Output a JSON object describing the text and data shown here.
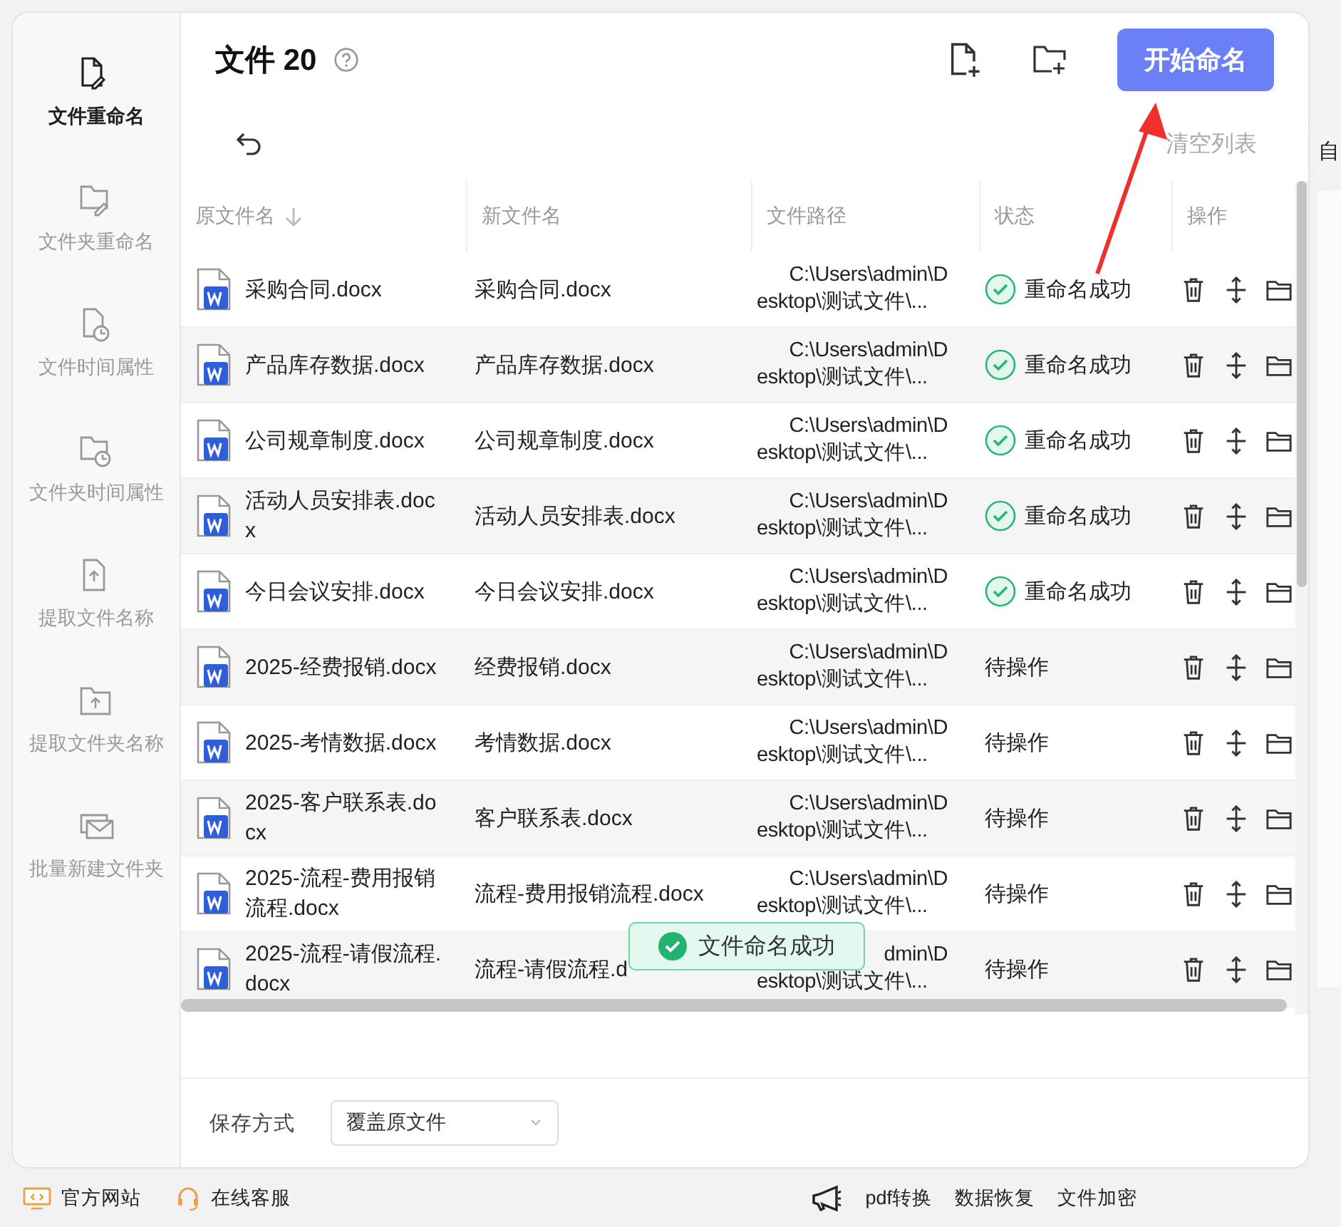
{
  "sidebar": {
    "items": [
      {
        "label": "文件重命名",
        "selected": true
      },
      {
        "label": "文件夹重命名",
        "selected": false
      },
      {
        "label": "文件时间属性",
        "selected": false
      },
      {
        "label": "文件夹时间属性",
        "selected": false
      },
      {
        "label": "提取文件名称",
        "selected": false
      },
      {
        "label": "提取文件夹名称",
        "selected": false
      },
      {
        "label": "批量新建文件夹",
        "selected": false
      }
    ]
  },
  "header": {
    "title": "文件 20",
    "start_button": "开始命名",
    "clear_link": "清空列表"
  },
  "table": {
    "columns": [
      "原文件名",
      "新文件名",
      "文件路径",
      "状态",
      "操作"
    ],
    "rows": [
      {
        "original": "采购合同.docx",
        "new": "采购合同.docx",
        "path": [
          "C:\\Users\\admin\\D",
          "esktop\\测试文件\\..."
        ],
        "status": "重命名成功",
        "kind": "success"
      },
      {
        "original": "产品库存数据.docx",
        "new": "产品库存数据.docx",
        "path": [
          "C:\\Users\\admin\\D",
          "esktop\\测试文件\\..."
        ],
        "status": "重命名成功",
        "kind": "success"
      },
      {
        "original": "公司规章制度.docx",
        "new": "公司规章制度.docx",
        "path": [
          "C:\\Users\\admin\\D",
          "esktop\\测试文件\\..."
        ],
        "status": "重命名成功",
        "kind": "success"
      },
      {
        "original": "活动人员安排表.docx",
        "new": "活动人员安排表.docx",
        "path": [
          "C:\\Users\\admin\\D",
          "esktop\\测试文件\\..."
        ],
        "status": "重命名成功",
        "kind": "success"
      },
      {
        "original": "今日会议安排.docx",
        "new": "今日会议安排.docx",
        "path": [
          "C:\\Users\\admin\\D",
          "esktop\\测试文件\\..."
        ],
        "status": "重命名成功",
        "kind": "success"
      },
      {
        "original": "2025-经费报销.docx",
        "new": "经费报销.docx",
        "path": [
          "C:\\Users\\admin\\D",
          "esktop\\测试文件\\..."
        ],
        "status": "待操作",
        "kind": "pending"
      },
      {
        "original": "2025-考情数据.docx",
        "new": "考情数据.docx",
        "path": [
          "C:\\Users\\admin\\D",
          "esktop\\测试文件\\..."
        ],
        "status": "待操作",
        "kind": "pending"
      },
      {
        "original": "2025-客户联系表.docx",
        "new": "客户联系表.docx",
        "path": [
          "C:\\Users\\admin\\D",
          "esktop\\测试文件\\..."
        ],
        "status": "待操作",
        "kind": "pending"
      },
      {
        "original": "2025-流程-费用报销流程.docx",
        "new": "流程-费用报销流程.docx",
        "path": [
          "C:\\Users\\admin\\D",
          "esktop\\测试文件\\..."
        ],
        "status": "待操作",
        "kind": "pending"
      },
      {
        "original": "2025-流程-请假流程.docx",
        "new": "流程-请假流程.d",
        "path": [
          "dmin\\D",
          "esktop\\测试文件\\..."
        ],
        "status": "待操作",
        "kind": "pending"
      }
    ]
  },
  "toast": {
    "message": "文件命名成功"
  },
  "footer": {
    "save_label": "保存方式",
    "save_mode": "覆盖原文件"
  },
  "right_panel": {
    "tab_fragment": "自"
  },
  "status_bar": {
    "left": [
      "官方网站",
      "在线客服"
    ],
    "right": [
      "pdf转换",
      "数据恢复",
      "文件加密"
    ]
  }
}
